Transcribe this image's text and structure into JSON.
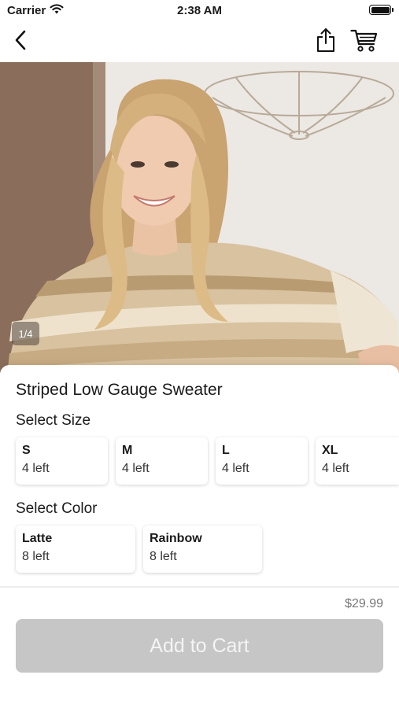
{
  "status_bar": {
    "carrier": "Carrier",
    "time": "2:38 AM"
  },
  "nav": {
    "back_icon": "chevron-left-icon",
    "share_icon": "share-icon",
    "cart_icon": "shopping-cart-icon"
  },
  "gallery": {
    "page_indicator": "1/4"
  },
  "product": {
    "title": "Striped Low Gauge Sweater",
    "price": "$29.99"
  },
  "size_section": {
    "label": "Select Size",
    "options": [
      {
        "name": "S",
        "stock": "4 left"
      },
      {
        "name": "M",
        "stock": "4 left"
      },
      {
        "name": "L",
        "stock": "4 left"
      },
      {
        "name": "XL",
        "stock": "4 left"
      }
    ]
  },
  "color_section": {
    "label": "Select Color",
    "options": [
      {
        "name": "Latte",
        "stock": "8 left"
      },
      {
        "name": "Rainbow",
        "stock": "8 left"
      }
    ]
  },
  "cart": {
    "add_label": "Add to Cart",
    "enabled": false
  },
  "colors": {
    "button_disabled_bg": "#c6c6c6",
    "button_disabled_text": "#f4f4f4",
    "price_text": "#777777"
  }
}
